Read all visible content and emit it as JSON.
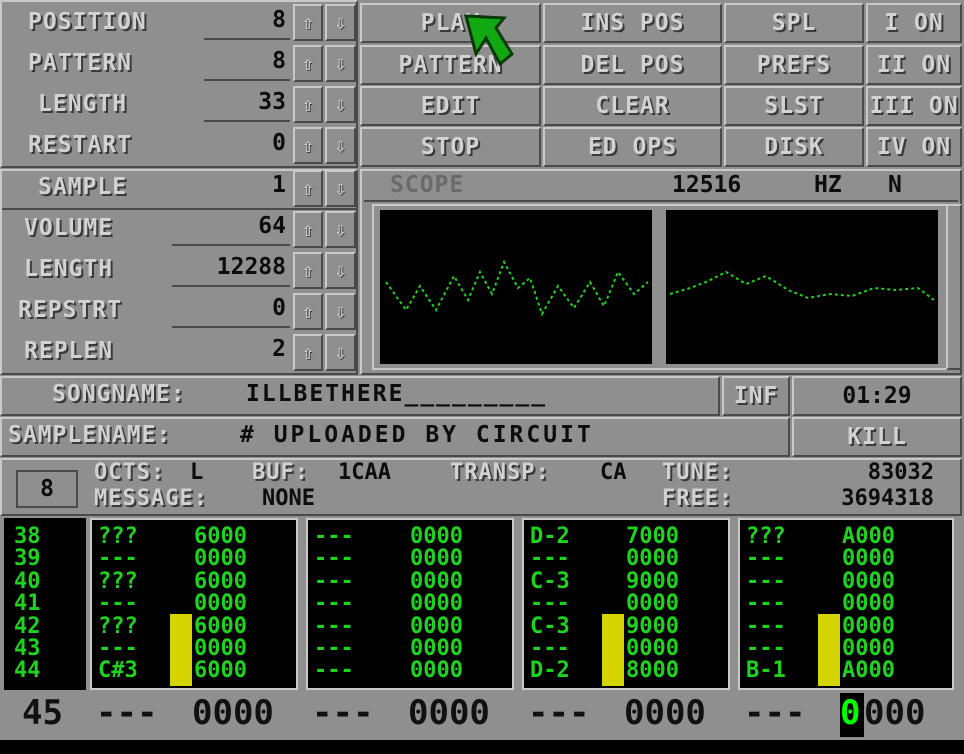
{
  "song_panel": {
    "position_label": "POSITION",
    "position_value": "8",
    "pattern_label": "PATTERN",
    "pattern_value": "8",
    "length_label": "LENGTH",
    "length_value": "33",
    "restart_label": "RESTART",
    "restart_value": "0"
  },
  "buttons": {
    "play": "PLAY",
    "pattern": "PATTERN",
    "edit": "EDIT",
    "stop": "STOP",
    "ins_pos": "INS POS",
    "del_pos": "DEL POS",
    "clear": "CLEAR",
    "ed_ops": "ED OPS",
    "spl": "SPL",
    "prefs": "PREFS",
    "slst": "SLST",
    "disk": "DISK"
  },
  "channels": {
    "ch1": "I ON",
    "ch2": "II ON",
    "ch3": "III ON",
    "ch4": "IV ON"
  },
  "sample_panel": {
    "sample_label": "SAMPLE",
    "sample_value": "1",
    "volume_label": "VOLUME",
    "volume_value": "64",
    "length_label": "LENGTH",
    "length_value": "12288",
    "repstrt_label": "REPSTRT",
    "repstrt_value": "0",
    "replen_label": "REPLEN",
    "replen_value": "2"
  },
  "scope": {
    "label": "SCOPE",
    "rate": "12516",
    "unit": "HZ",
    "mode": "N"
  },
  "song": {
    "songname_label": "SONGNAME:",
    "songname_value": "ILLBETHERE_________",
    "inf": "INF",
    "time": "01:29"
  },
  "sampleinfo": {
    "samplename_label": "SAMPLENAME:",
    "samplename_value": "# UPLOADED BY CIRCUIT",
    "kill": "KILL"
  },
  "status": {
    "octave_box": "8",
    "octs_label": "OCTS:",
    "octs_value": "L",
    "buf_label": "BUF:",
    "buf_value": "1CAA",
    "transp_label": "TRANSP:",
    "transp_value": "CA",
    "tune_label": "TUNE:",
    "tune_value": "83032",
    "message_label": "MESSAGE:",
    "message_value": "NONE",
    "free_label": "FREE:",
    "free_value": "3694318"
  },
  "pattern": {
    "rows": [
      "38",
      "39",
      "40",
      "41",
      "42",
      "43",
      "44"
    ],
    "tracks": [
      {
        "notes": [
          "???",
          "---",
          "???",
          "---",
          "???",
          "---",
          "C#3"
        ],
        "effects": [
          "6000",
          "0000",
          "6000",
          "0000",
          "6000",
          "0000",
          "6000"
        ]
      },
      {
        "notes": [
          "---",
          "---",
          "---",
          "---",
          "---",
          "---",
          "---"
        ],
        "effects": [
          "0000",
          "0000",
          "0000",
          "0000",
          "0000",
          "0000",
          "0000"
        ]
      },
      {
        "notes": [
          "D-2",
          "---",
          "C-3",
          "---",
          "C-3",
          "---",
          "D-2"
        ],
        "effects": [
          "7000",
          "0000",
          "9000",
          "0000",
          "9000",
          "0000",
          "8000"
        ]
      },
      {
        "notes": [
          "???",
          "---",
          "---",
          "---",
          "---",
          "---",
          "B-1"
        ],
        "effects": [
          "A000",
          "0000",
          "0000",
          "0000",
          "0000",
          "0000",
          "A000"
        ]
      }
    ],
    "current_row": "45",
    "current": [
      {
        "note": "---",
        "effect": "0000"
      },
      {
        "note": "---",
        "effect": "0000"
      },
      {
        "note": "---",
        "effect": "0000"
      },
      {
        "note": "---",
        "effect": "0000"
      }
    ],
    "cursor_char": "0",
    "cursor_rest": "000"
  },
  "colors": {
    "panel": "#8f8f8f",
    "green": "#1dd31d",
    "vu": "#d4d400",
    "cursor": "#00ff00"
  }
}
